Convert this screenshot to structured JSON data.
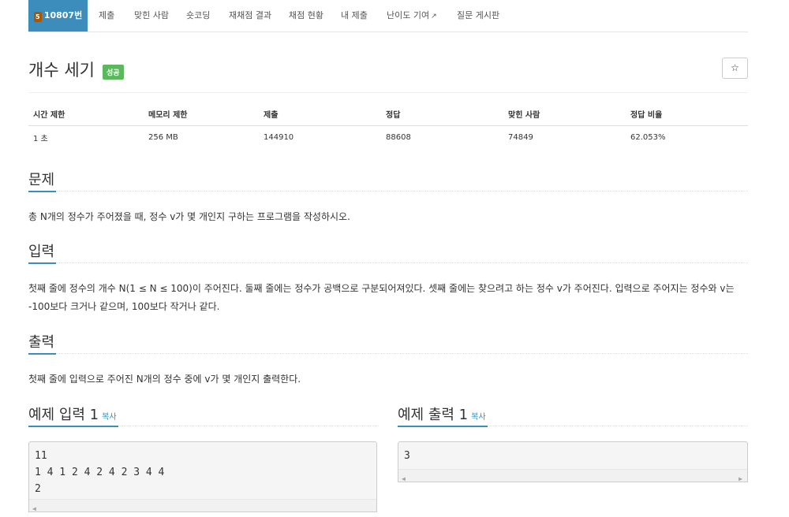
{
  "tabs": [
    {
      "label": "10807번",
      "badge": "5",
      "active": true
    },
    {
      "label": "제출"
    },
    {
      "label": "맞힌 사람"
    },
    {
      "label": "숏코딩"
    },
    {
      "label": "재채점 결과"
    },
    {
      "label": "채점 현황"
    },
    {
      "label": "내 제출"
    },
    {
      "label": "난이도 기여",
      "external_icon": "external-link-icon"
    },
    {
      "label": "질문 게시판"
    }
  ],
  "problem": {
    "title": "개수 세기",
    "status_label": "성공",
    "star_icon": "☆"
  },
  "info_table": {
    "headers": [
      "시간 제한",
      "메모리 제한",
      "제출",
      "정답",
      "맞힌 사람",
      "정답 비율"
    ],
    "values": [
      "1 초",
      "256 MB",
      "144910",
      "88608",
      "74849",
      "62.053%"
    ]
  },
  "sections": {
    "problem": {
      "heading": "문제",
      "text": "총 N개의 정수가 주어졌을 때, 정수 v가 몇 개인지 구하는 프로그램을 작성하시오."
    },
    "input": {
      "heading": "입력",
      "text": "첫째 줄에 정수의 개수 N(1 ≤ N ≤ 100)이 주어진다. 둘째 줄에는 정수가 공백으로 구분되어져있다. 셋째 줄에는 찾으려고 하는 정수 v가 주어진다. 입력으로 주어지는 정수와 v는 -100보다 크거나 같으며, 100보다 작거나 같다."
    },
    "output": {
      "heading": "출력",
      "text": "첫째 줄에 입력으로 주어진 N개의 정수 중에 v가 몇 개인지 출력한다."
    }
  },
  "samples": {
    "input": {
      "heading": "예제 입력 1",
      "copy": "복사",
      "content": "11\n1 4 1 2 4 2 4 2 3 4 4\n2"
    },
    "output": {
      "heading": "예제 출력 1",
      "copy": "복사",
      "content": "3"
    }
  },
  "colors": {
    "accent": "#3c8dbc",
    "success": "#5cb85c",
    "badge": "#ad5600"
  }
}
